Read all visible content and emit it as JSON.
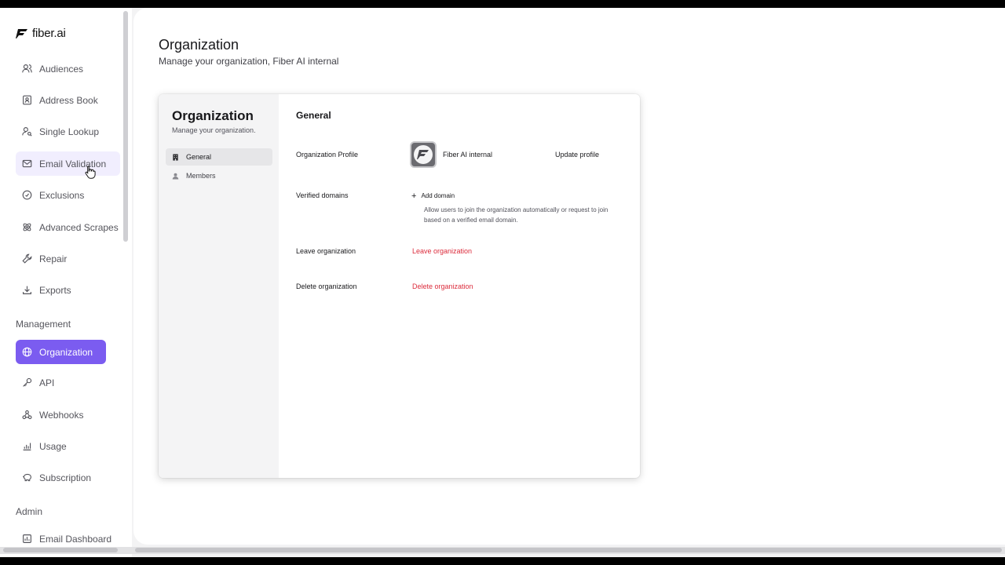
{
  "app": {
    "logo_text": "fiber.ai",
    "accent": "#7b5cf0",
    "danger": "#dc2c3c"
  },
  "sidebar": {
    "items": [
      {
        "label": "Audiences",
        "icon": "users-icon"
      },
      {
        "label": "Address Book",
        "icon": "address-book-icon"
      },
      {
        "label": "Single Lookup",
        "icon": "user-search-icon"
      },
      {
        "label": "Email Validation",
        "icon": "mail-icon"
      },
      {
        "label": "Exclusions",
        "icon": "circle-check-icon"
      },
      {
        "label": "Advanced Scrapes",
        "icon": "atom-icon"
      },
      {
        "label": "Repair",
        "icon": "wrench-icon"
      },
      {
        "label": "Exports",
        "icon": "download-icon"
      }
    ],
    "management_label": "Management",
    "management_items": [
      {
        "label": "Organization",
        "icon": "globe-icon"
      },
      {
        "label": "API",
        "icon": "key-icon"
      },
      {
        "label": "Webhooks",
        "icon": "webhook-icon"
      },
      {
        "label": "Usage",
        "icon": "chart-icon"
      },
      {
        "label": "Subscription",
        "icon": "piggy-bank-icon"
      }
    ],
    "admin_label": "Admin",
    "admin_items": [
      {
        "label": "Email Dashboard",
        "icon": "dashboard-icon"
      }
    ]
  },
  "page": {
    "title": "Organization",
    "subtitle": "Manage your organization, Fiber AI internal"
  },
  "card": {
    "title": "Organization",
    "subtitle": "Manage your organization.",
    "nav": [
      {
        "label": "General",
        "icon": "building-icon"
      },
      {
        "label": "Members",
        "icon": "members-icon"
      }
    ],
    "section_title": "General",
    "profile_label": "Organization Profile",
    "org_name": "Fiber AI internal",
    "update_profile": "Update profile",
    "domains_label": "Verified domains",
    "add_domain": "Add domain",
    "domains_help": "Allow users to join the organization automatically or request to join based on a verified email domain.",
    "leave_label": "Leave organization",
    "leave_link": "Leave organization",
    "delete_label": "Delete organization",
    "delete_link": "Delete organization"
  }
}
